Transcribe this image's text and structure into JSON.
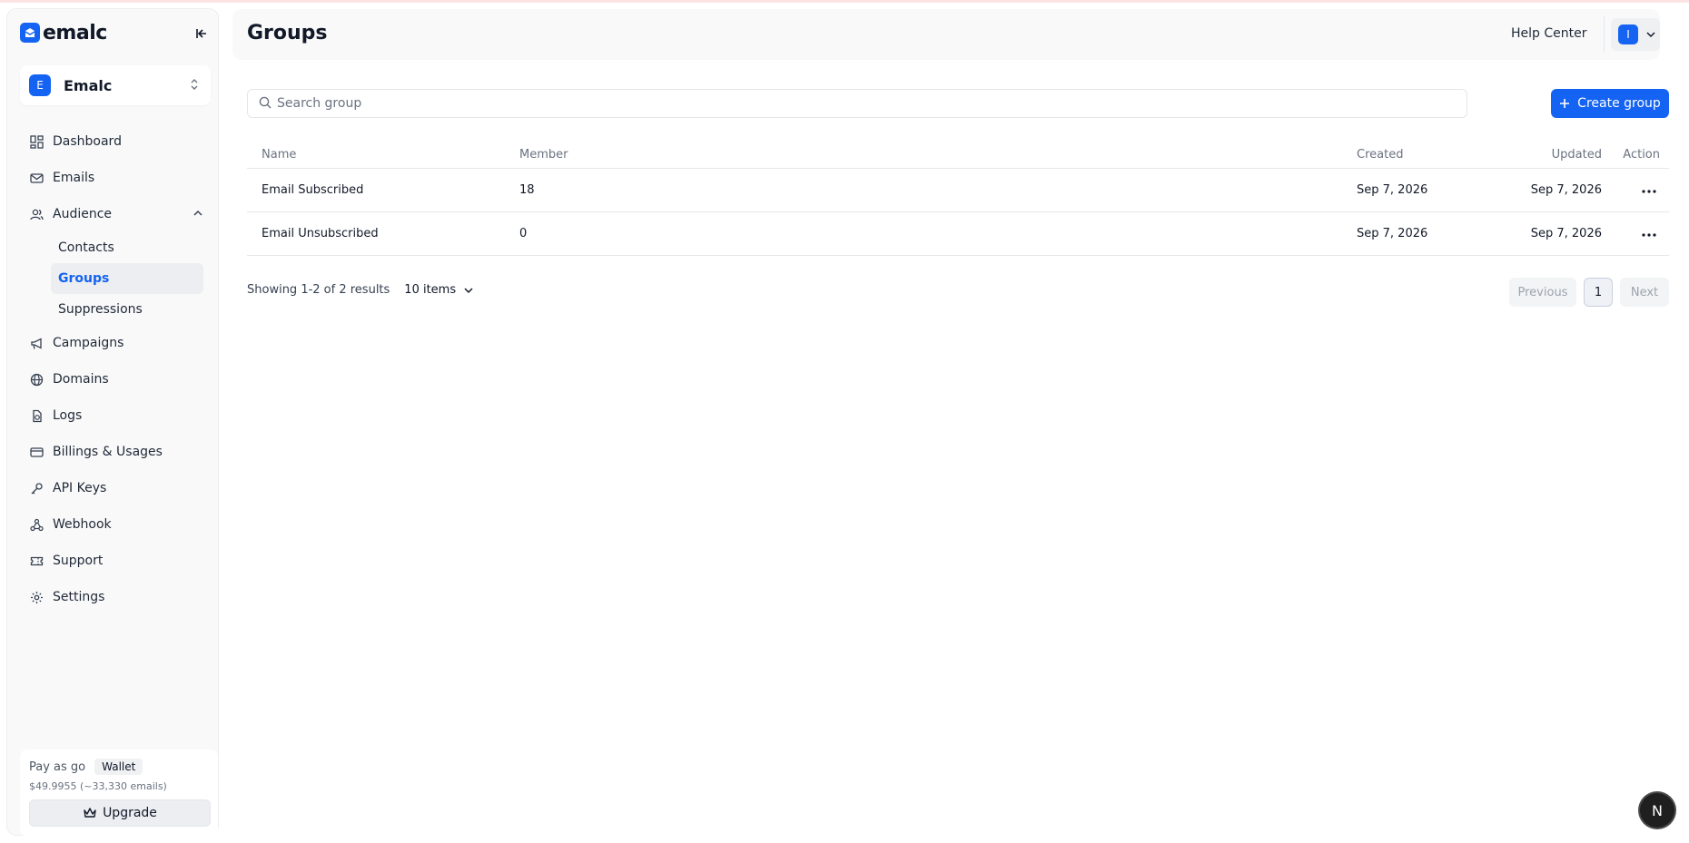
{
  "brand": {
    "name": "emalc",
    "accent": "#1463f3"
  },
  "workspace": {
    "initial": "E",
    "name": "Emalc"
  },
  "sidebar": {
    "items": [
      {
        "label": "Dashboard",
        "icon": "dashboard-icon"
      },
      {
        "label": "Emails",
        "icon": "mail-icon"
      },
      {
        "label": "Audience",
        "icon": "users-icon",
        "expanded": true,
        "children": [
          {
            "label": "Contacts"
          },
          {
            "label": "Groups",
            "active": true
          },
          {
            "label": "Suppressions"
          }
        ]
      },
      {
        "label": "Campaigns",
        "icon": "megaphone-icon"
      },
      {
        "label": "Domains",
        "icon": "globe-icon"
      },
      {
        "label": "Logs",
        "icon": "logs-icon"
      },
      {
        "label": "Billings & Usages",
        "icon": "card-icon"
      },
      {
        "label": "API Keys",
        "icon": "key-icon"
      },
      {
        "label": "Webhook",
        "icon": "webhook-icon"
      },
      {
        "label": "Support",
        "icon": "ticket-icon"
      },
      {
        "label": "Settings",
        "icon": "gear-icon"
      }
    ]
  },
  "plan": {
    "name": "Pay as go",
    "badge": "Wallet",
    "balance": "$49.9955 (~33,330 emails)",
    "upgrade_label": "Upgrade"
  },
  "header": {
    "title": "Groups",
    "help_label": "Help Center",
    "user_initial": "I"
  },
  "toolbar": {
    "search_placeholder": "Search group",
    "create_label": "Create group"
  },
  "table": {
    "columns": {
      "name": "Name",
      "member": "Member",
      "created": "Created",
      "updated": "Updated",
      "action": "Action"
    },
    "rows": [
      {
        "name": "Email Subscribed",
        "member": "18",
        "created": "Sep 7, 2026",
        "updated": "Sep 7, 2026"
      },
      {
        "name": "Email Unsubscribed",
        "member": "0",
        "created": "Sep 7, 2026",
        "updated": "Sep 7, 2026"
      }
    ]
  },
  "pagination": {
    "summary": "Showing 1-2 of 2 results",
    "page_size": "10 items",
    "previous": "Previous",
    "current_page": "1",
    "next": "Next"
  },
  "dev_badge": "N"
}
